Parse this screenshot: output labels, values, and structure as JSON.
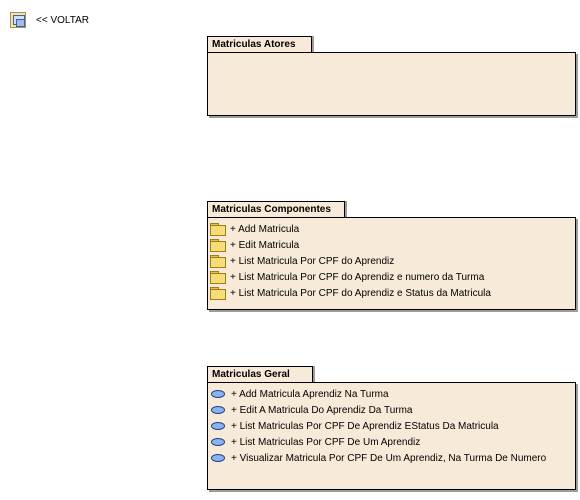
{
  "back": {
    "label": "<< VOLTAR",
    "icon": "diagram-link-icon"
  },
  "packages": [
    {
      "title": "Matriculas Atores",
      "item_icon": "folder-icon",
      "items": []
    },
    {
      "title": "Matriculas Componentes",
      "item_icon": "folder-icon",
      "items": [
        "+ Add Matricula",
        "+ Edit Matricula",
        "+ List Matricula Por CPF do Aprendiz",
        "+ List Matricula Por CPF do Aprendiz e numero da Turma",
        "+ List Matricula Por CPF do Aprendiz e Status da Matricula"
      ]
    },
    {
      "title": "Matriculas Geral",
      "item_icon": "use-case-icon",
      "items": [
        "+ Add Matricula Aprendiz Na Turma",
        "+ Edit A Matricula Do Aprendiz Da Turma",
        "+ List Matriculas Por CPF De Aprendiz EStatus Da Matricula",
        "+ List Matriculas Por CPF De Um Aprendiz",
        "+ Visualizar Matricula Por CPF De Um Aprendiz, Na Turma De Numero"
      ]
    }
  ],
  "colors": {
    "package_fill": "#f8ead8",
    "border": "#000000",
    "shadow": "#9c9c9c"
  }
}
